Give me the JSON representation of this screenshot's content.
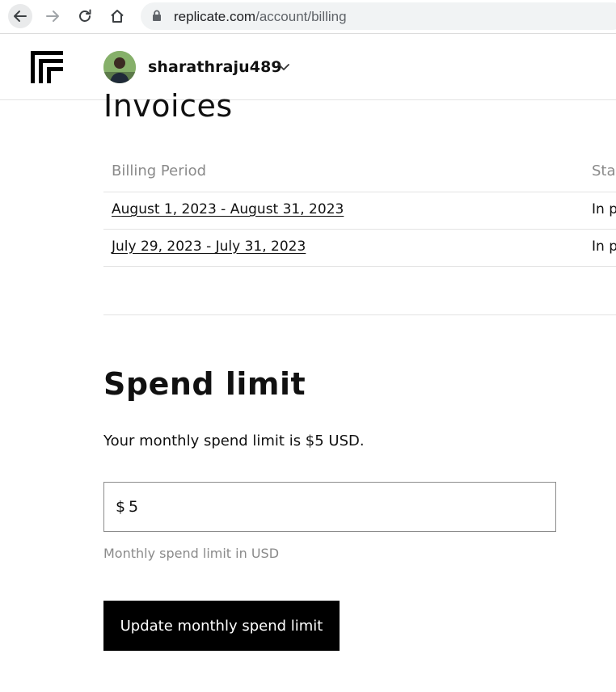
{
  "browser": {
    "url_host": "replicate.com",
    "url_path": "/account/billing"
  },
  "header": {
    "username": "sharathraju489"
  },
  "invoices": {
    "title": "Invoices",
    "columns": [
      "Billing Period",
      "Sta"
    ],
    "rows": [
      {
        "period": "August 1, 2023 - August 31, 2023",
        "status": "In p"
      },
      {
        "period": "July 29, 2023 - July 31, 2023",
        "status": "In p"
      }
    ]
  },
  "spend_limit": {
    "title": "Spend limit",
    "description": "Your monthly spend limit is $5 USD.",
    "currency_symbol": "$",
    "input_value": "5",
    "hint": "Monthly spend limit in USD",
    "button_label": "Update monthly spend limit"
  },
  "colors": {
    "button_bg": "#000000",
    "muted_text": "#8a8a8a",
    "divider": "#e3e3e3"
  }
}
